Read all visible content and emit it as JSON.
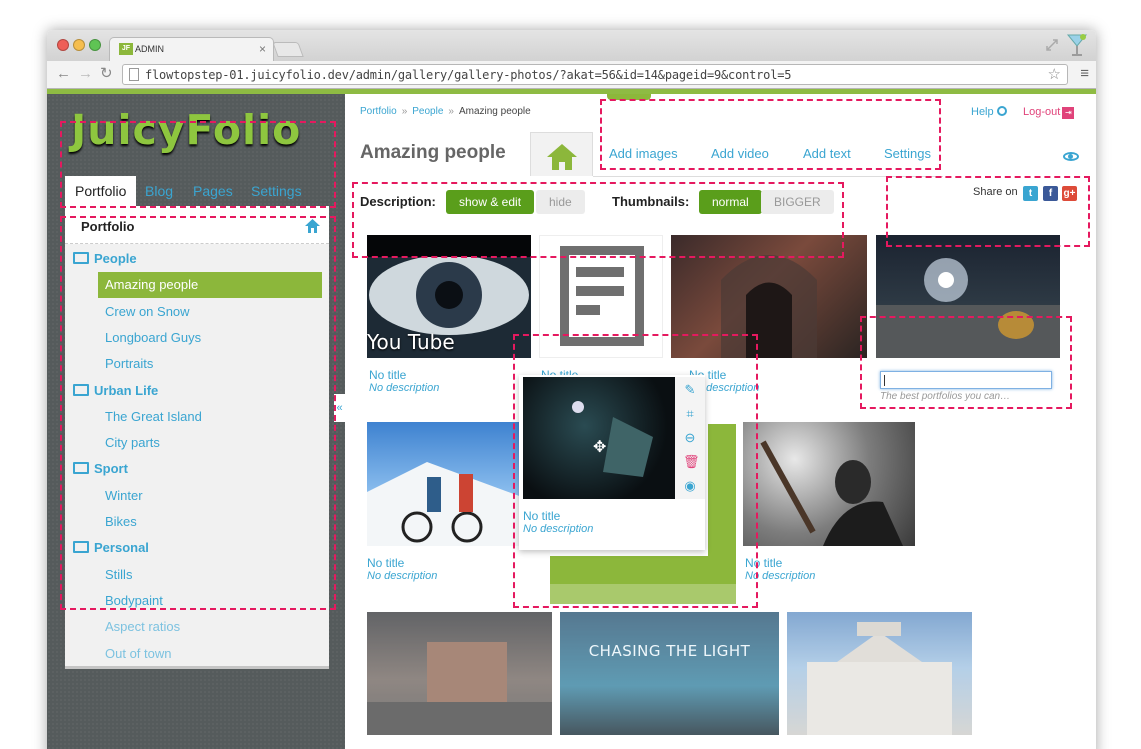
{
  "browser": {
    "tab_title": "ADMIN",
    "tab_icon": "JF",
    "url": "flowtopstep-01.juicyfolio.dev/admin/gallery/gallery-photos/?akat=56&id=14&pageid=9&control=5"
  },
  "logo": "JuicyFolio",
  "side_tabs": [
    "Portfolio",
    "Blog",
    "Pages",
    "Settings"
  ],
  "side_panel": {
    "title": "Portfolio",
    "tree": [
      {
        "label": "People",
        "type": "folder"
      },
      {
        "label": "Amazing people",
        "type": "child",
        "selected": true
      },
      {
        "label": "Crew on Snow",
        "type": "child"
      },
      {
        "label": "Longboard Guys",
        "type": "child"
      },
      {
        "label": "Portraits",
        "type": "child"
      },
      {
        "label": "Urban Life",
        "type": "folder"
      },
      {
        "label": "The Great Island",
        "type": "child"
      },
      {
        "label": "City parts",
        "type": "child"
      },
      {
        "label": "Sport",
        "type": "folder"
      },
      {
        "label": "Winter",
        "type": "child"
      },
      {
        "label": "Bikes",
        "type": "child"
      },
      {
        "label": "Personal",
        "type": "folder"
      },
      {
        "label": "Stills",
        "type": "child"
      },
      {
        "label": "Bodypaint",
        "type": "child"
      },
      {
        "label": "Aspect ratios",
        "type": "child",
        "faded": true
      },
      {
        "label": "Out of town",
        "type": "child",
        "faded": true
      }
    ],
    "collapse_glyph": "«"
  },
  "breadcrumb": [
    "Portfolio",
    "People",
    "Amazing people"
  ],
  "breadcrumb_sep": "»",
  "help_label": "Help",
  "logout_label": "Log-out",
  "page_title": "Amazing people",
  "actions": [
    "Add images",
    "Add video",
    "Add text",
    "Settings"
  ],
  "description_label": "Description:",
  "description_options": [
    "show & edit",
    "hide"
  ],
  "thumbnails_label": "Thumbnails:",
  "thumbnail_options": [
    "normal",
    "BIGGER"
  ],
  "share_label": "Share on",
  "youtube_label": "You Tube",
  "captions": {
    "title": "No title",
    "desc": "No description",
    "note_placeholder": "The best portfolios you can…"
  },
  "chasing_text": "CHASING THE LIGHT",
  "colors": {
    "accent_green": "#8cb73b",
    "link_blue": "#3aa5d1",
    "highlight_pink": "#e5195f"
  }
}
